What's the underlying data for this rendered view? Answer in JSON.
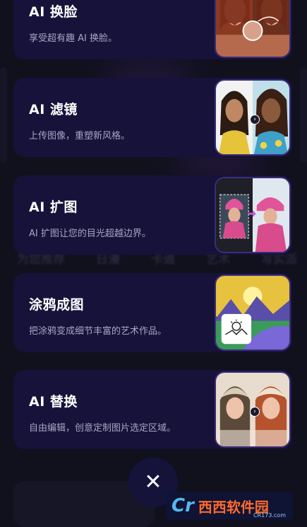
{
  "background": {
    "category_tabs": [
      "为您推荐",
      "日漫",
      "卡通",
      "艺术",
      "写实派"
    ]
  },
  "features": [
    {
      "title": "AI 换脸",
      "desc": "享受超有趣 AI 换脸。",
      "thumb": "face-swap-thumbnail"
    },
    {
      "title": "AI 滤镜",
      "desc": "上传图像，重塑新风格。",
      "thumb": "filter-thumbnail"
    },
    {
      "title": "AI 扩图",
      "desc": "AI 扩图让您的目光超越边界。",
      "thumb": "expand-thumbnail"
    },
    {
      "title": "涂鸦成图",
      "desc": "把涂鸦变成细节丰富的艺术作品。",
      "thumb": "doodle-thumbnail"
    },
    {
      "title": "AI 替换",
      "desc": "自由编辑，创意定制图片选定区域。",
      "thumb": "replace-thumbnail"
    }
  ],
  "close": {
    "label": "✕",
    "icon": "close-icon"
  },
  "watermark": {
    "text": "西西软件园",
    "sub": "CR173.com"
  },
  "colors": {
    "card_bg": "#16123a",
    "page_bg": "#171626",
    "desc": "#a8a6c4",
    "accent": "#7b4bff"
  }
}
